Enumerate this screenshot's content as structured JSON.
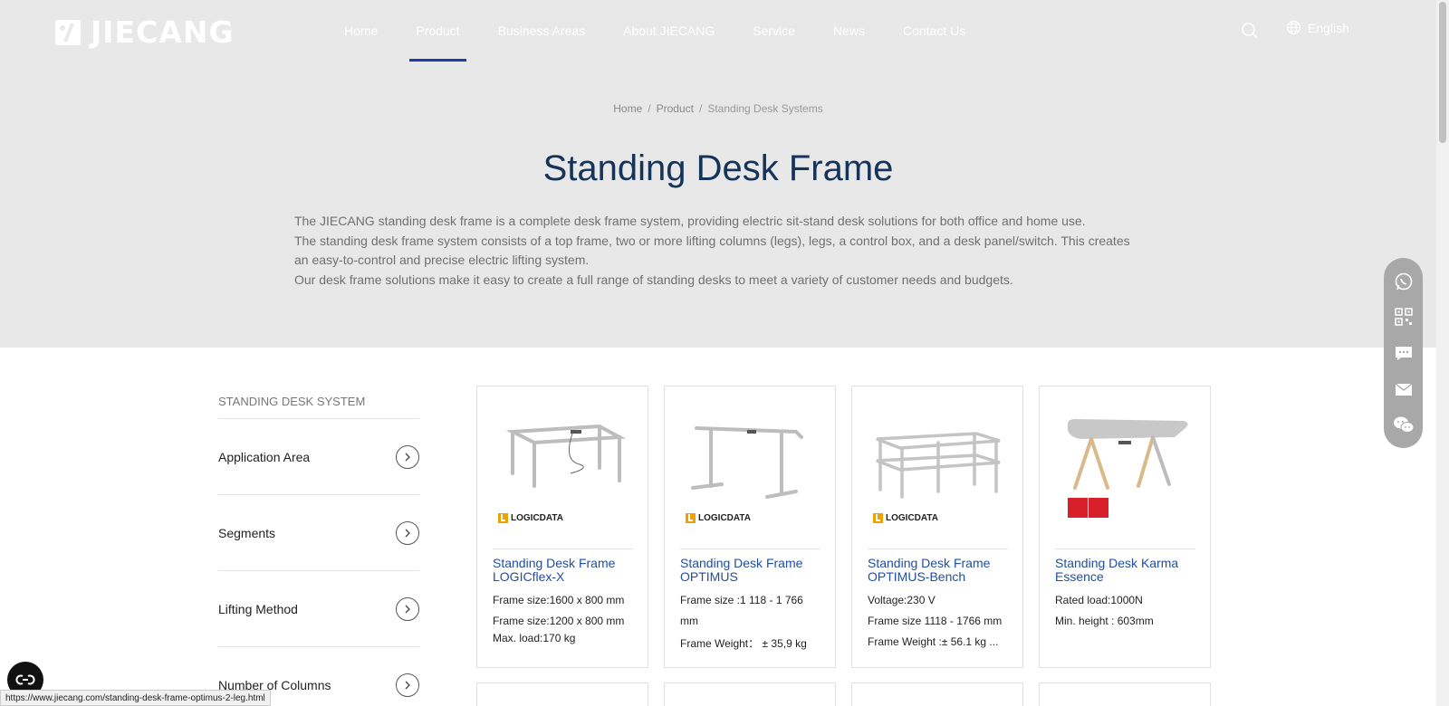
{
  "brand": {
    "name": "JIECANG",
    "logo_icon": "jiecang-logo-icon"
  },
  "nav": {
    "items": [
      "Home",
      "Product",
      "Business Areas",
      "About JIECANG",
      "Service",
      "News",
      "Contact Us"
    ],
    "active": "Product"
  },
  "header": {
    "search_icon": "search-icon",
    "language": "English",
    "language_icon": "globe-icon"
  },
  "breadcrumb": [
    "Home",
    "Product",
    "Standing Desk Systems"
  ],
  "page": {
    "title": "Standing Desk Frame",
    "intro": [
      "The JIECANG standing desk frame is a complete desk frame system, providing electric sit-stand desk solutions for both office and home use.",
      "The standing desk frame system consists of a top frame, two or more lifting columns (legs), legs, a control box, and a desk panel/switch. This creates an easy-to-control and precise electric lifting system.",
      "Our desk frame solutions make it easy to create a full range of standing desks to meet a variety of customer needs and budgets."
    ]
  },
  "sidebar": {
    "title": "STANDING DESK SYSTEM",
    "filters": [
      "Application Area",
      "Segments",
      "Lifting Method",
      "Number of Columns"
    ],
    "filter_icon": "chevron-right-circle-icon"
  },
  "products": [
    {
      "name": "Standing Desk Frame LOGICflex-X",
      "brand_label": "LOGICDATA",
      "specs": [
        "Frame size:1600 x 800 mm",
        "Frame size:1200 x 800 mm",
        "Max. load:170 kg"
      ]
    },
    {
      "name": "Standing Desk Frame OPTIMUS",
      "brand_label": "LOGICDATA",
      "specs": [
        "Frame size :1 118 - 1 766",
        "mm",
        "Frame Weight： ± 35,9 kg"
      ]
    },
    {
      "name": "Standing Desk Frame OPTIMUS-Bench",
      "brand_label": "LOGICDATA",
      "specs": [
        "Voltage:230 V",
        "Frame size 1118 - 1766 mm",
        "Frame Weight :± 56.1 kg ..."
      ]
    },
    {
      "name": "Standing Desk Karma Essence",
      "brand_label": "",
      "award_icon": "design-award-2022-icon",
      "specs": [
        "Rated load:1000N",
        "Min. height : 603mm"
      ]
    }
  ],
  "float_bar": [
    "whatsapp-icon",
    "qr-code-icon",
    "chat-icon",
    "mail-icon",
    "wechat-icon"
  ],
  "status_bar": {
    "url": "https://www.jiecang.com/standing-desk-frame-optimus-2-leg.html"
  },
  "cookie_button": "cookie-consent-icon",
  "colors": {
    "title": "#16335a",
    "link": "#1f4fa0",
    "hero_bg": "#e8e8e8",
    "active_nav": "#1b3ea8"
  }
}
